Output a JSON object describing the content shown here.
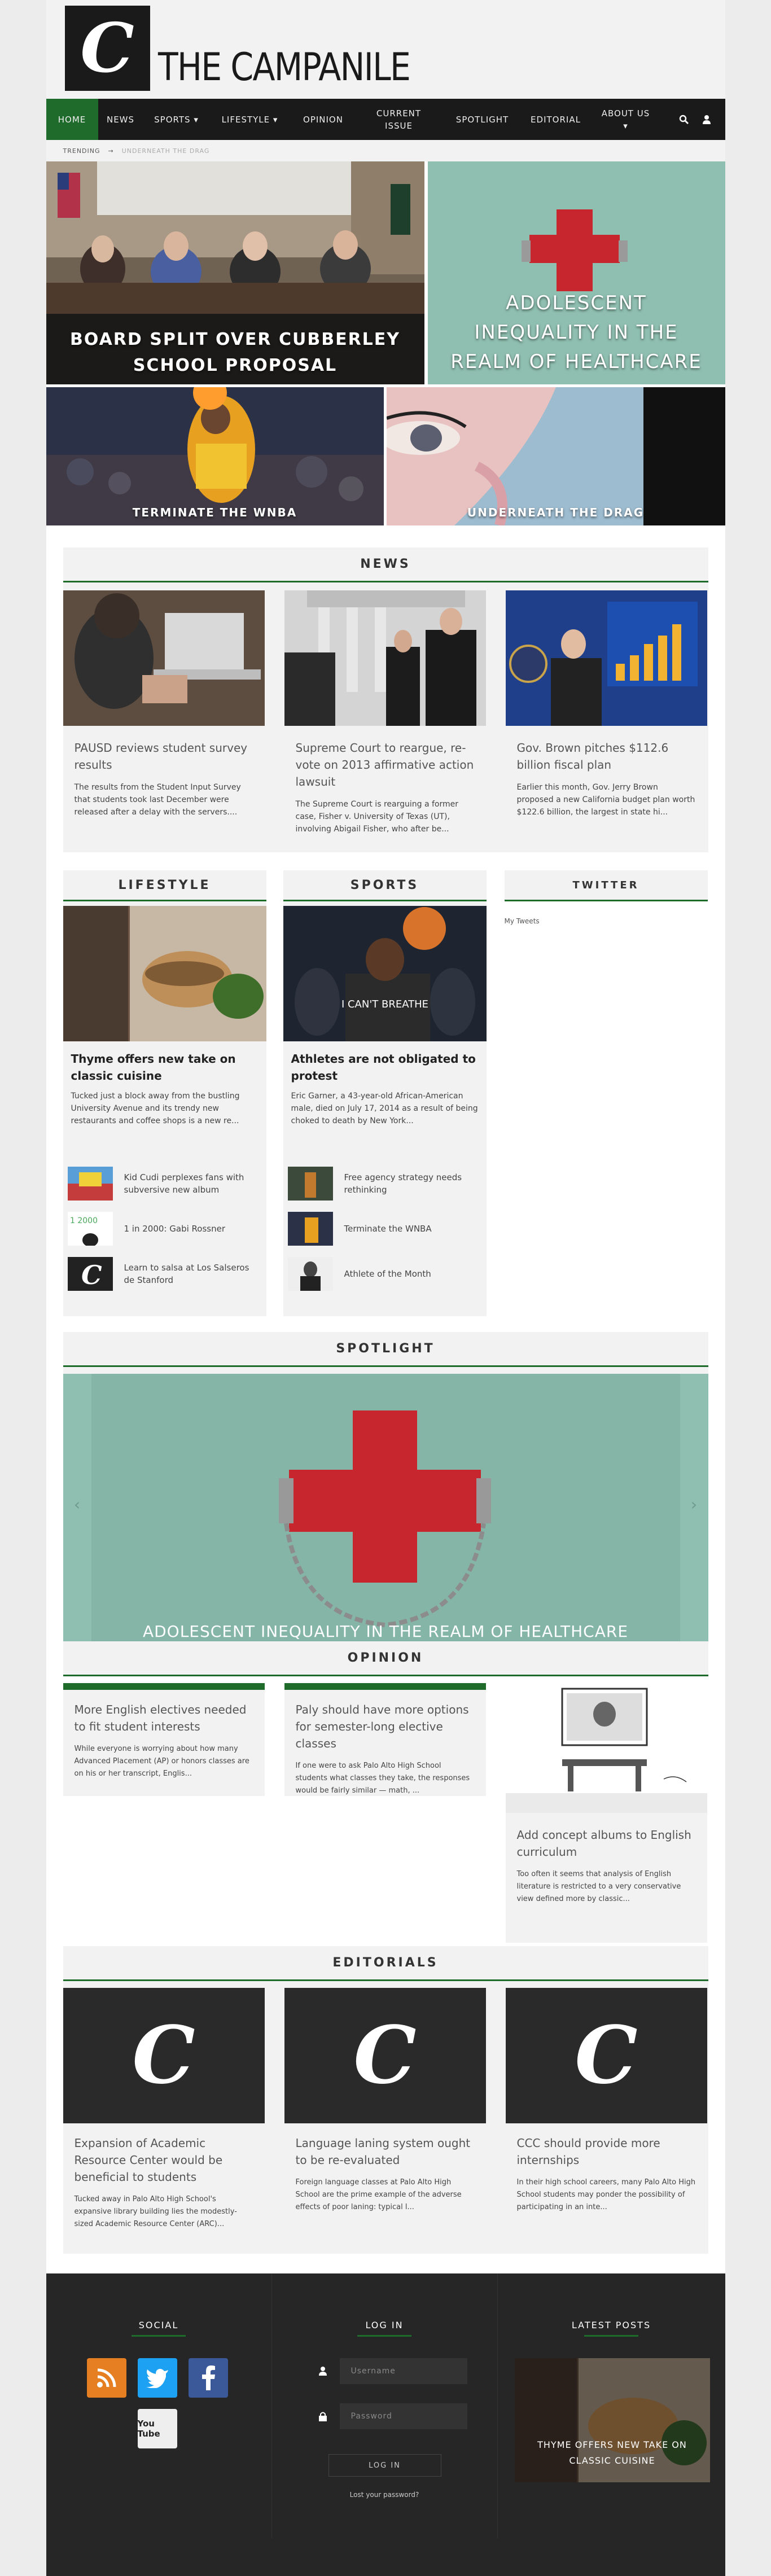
{
  "site": {
    "title": "THE CAMPANILE",
    "logo_letter": "C"
  },
  "nav": [
    {
      "label": "HOME"
    },
    {
      "label": "NEWS"
    },
    {
      "label": "SPORTS ▾"
    },
    {
      "label": "LIFESTYLE ▾"
    },
    {
      "label": "OPINION"
    },
    {
      "label": "CURRENT ISSUE"
    },
    {
      "label": "SPOTLIGHT"
    },
    {
      "label": "EDITORIAL"
    },
    {
      "label": "ABOUT US ▾"
    }
  ],
  "trending": {
    "label": "TRENDING",
    "arrow": "→",
    "item": "UNDERNEATH THE DRAG"
  },
  "hero": {
    "main_caption": "BOARD SPLIT OVER CUBBERLEY SCHOOL PROPOSAL",
    "right_caption": "ADOLESCENT INEQUALITY IN THE REALM OF HEALTHCARE",
    "bottom_left_caption": "TERMINATE THE WNBA",
    "bottom_right_caption": "UNDERNEATH THE DRAG"
  },
  "news": {
    "heading": "NEWS",
    "items": [
      {
        "title": "PAUSD reviews student survey results",
        "excerpt": "The results from the Student Input Survey that students took last December were released after a delay with the servers...."
      },
      {
        "title": "Supreme Court to reargue, re-vote on 2013 affirmative action lawsuit",
        "excerpt": "The Supreme Court is rearguing a former case, Fisher v. University of Texas (UT), involving Abigail Fisher, who after be..."
      },
      {
        "title": "Gov. Brown pitches $112.6 billion fiscal plan",
        "excerpt": "Earlier this month, Gov. Jerry Brown proposed a new California budget plan worth $122.6 billion, the largest in state hi..."
      }
    ]
  },
  "lifestyle": {
    "heading": "LIFESTYLE",
    "lead_title": "Thyme offers new take on classic cuisine",
    "lead_excerpt": "Tucked just a block away from the bustling University Avenue and its trendy new restaurants and coffee shops is a new re...",
    "items": [
      {
        "label": "Kid Cudi perplexes fans with subversive new album"
      },
      {
        "label": "1 in 2000: Gabi Rossner"
      },
      {
        "label": "Learn to salsa at Los Salseros de Stanford"
      }
    ]
  },
  "sports": {
    "heading": "SPORTS",
    "lead_title": "Athletes are not obligated to protest",
    "lead_excerpt": "Eric Garner, a 43-year-old African-American male, died on July 17, 2014 as a result of being choked to death by New York...",
    "items": [
      {
        "label": "Free agency strategy needs rethinking"
      },
      {
        "label": "Terminate the WNBA"
      },
      {
        "label": "Athlete of the Month"
      }
    ],
    "jersey_text": "I CAN'T BREATHE"
  },
  "twitter": {
    "heading": "TWITTER",
    "text": "My Tweets"
  },
  "spotlight": {
    "heading": "SPOTLIGHT",
    "caption": "ADOLESCENT INEQUALITY IN THE REALM OF HEALTHCARE",
    "prev": "‹",
    "next": "›"
  },
  "opinion": {
    "heading": "OPINION",
    "items": [
      {
        "title": "More English electives needed to fit student interests",
        "excerpt": "While everyone is worrying about how many Advanced Placement (AP) or honors classes are on his or her transcript, Englis..."
      },
      {
        "title": "Paly should have more options for semester-long elective classes",
        "excerpt": "If one were to ask Palo Alto High School students what classes they take, the responses would be fairly similar — math, ..."
      },
      {
        "title": "Add concept albums to English curriculum",
        "excerpt": "Too often it seems that analysis of English literature is restricted to a very conservative view defined more by classic..."
      }
    ]
  },
  "editorials": {
    "heading": "EDITORIALS",
    "items": [
      {
        "title": "Expansion of Academic Resource Center would be beneficial to students",
        "excerpt": "Tucked away in Palo Alto High School's expansive library building lies the modestly-sized Academic Resource Center (ARC)..."
      },
      {
        "title": "Language laning system ought to be re-evaluated",
        "excerpt": "Foreign language classes at Palo Alto High School are the prime example of the adverse effects of poor laning: typical l..."
      },
      {
        "title": "CCC should provide more internships",
        "excerpt": "In their high school careers, many Palo Alto High School students may ponder the possibility of participating in an inte..."
      }
    ]
  },
  "footer": {
    "social_heading": "SOCIAL",
    "login_heading": "LOG IN",
    "latest_heading": "LATEST POSTS",
    "username_placeholder": "Username",
    "password_placeholder": "Password",
    "login_button": "LOG IN",
    "lost_password": "Lost your password?",
    "latest_caption": "THYME OFFERS NEW TAKE ON CLASSIC CUISINE",
    "youtube_label": "You Tube"
  },
  "colors": {
    "accent": "#1f6b2c",
    "dark": "#1a1a1a",
    "teal": "#8fbfb0",
    "cross": "#c8262e"
  }
}
